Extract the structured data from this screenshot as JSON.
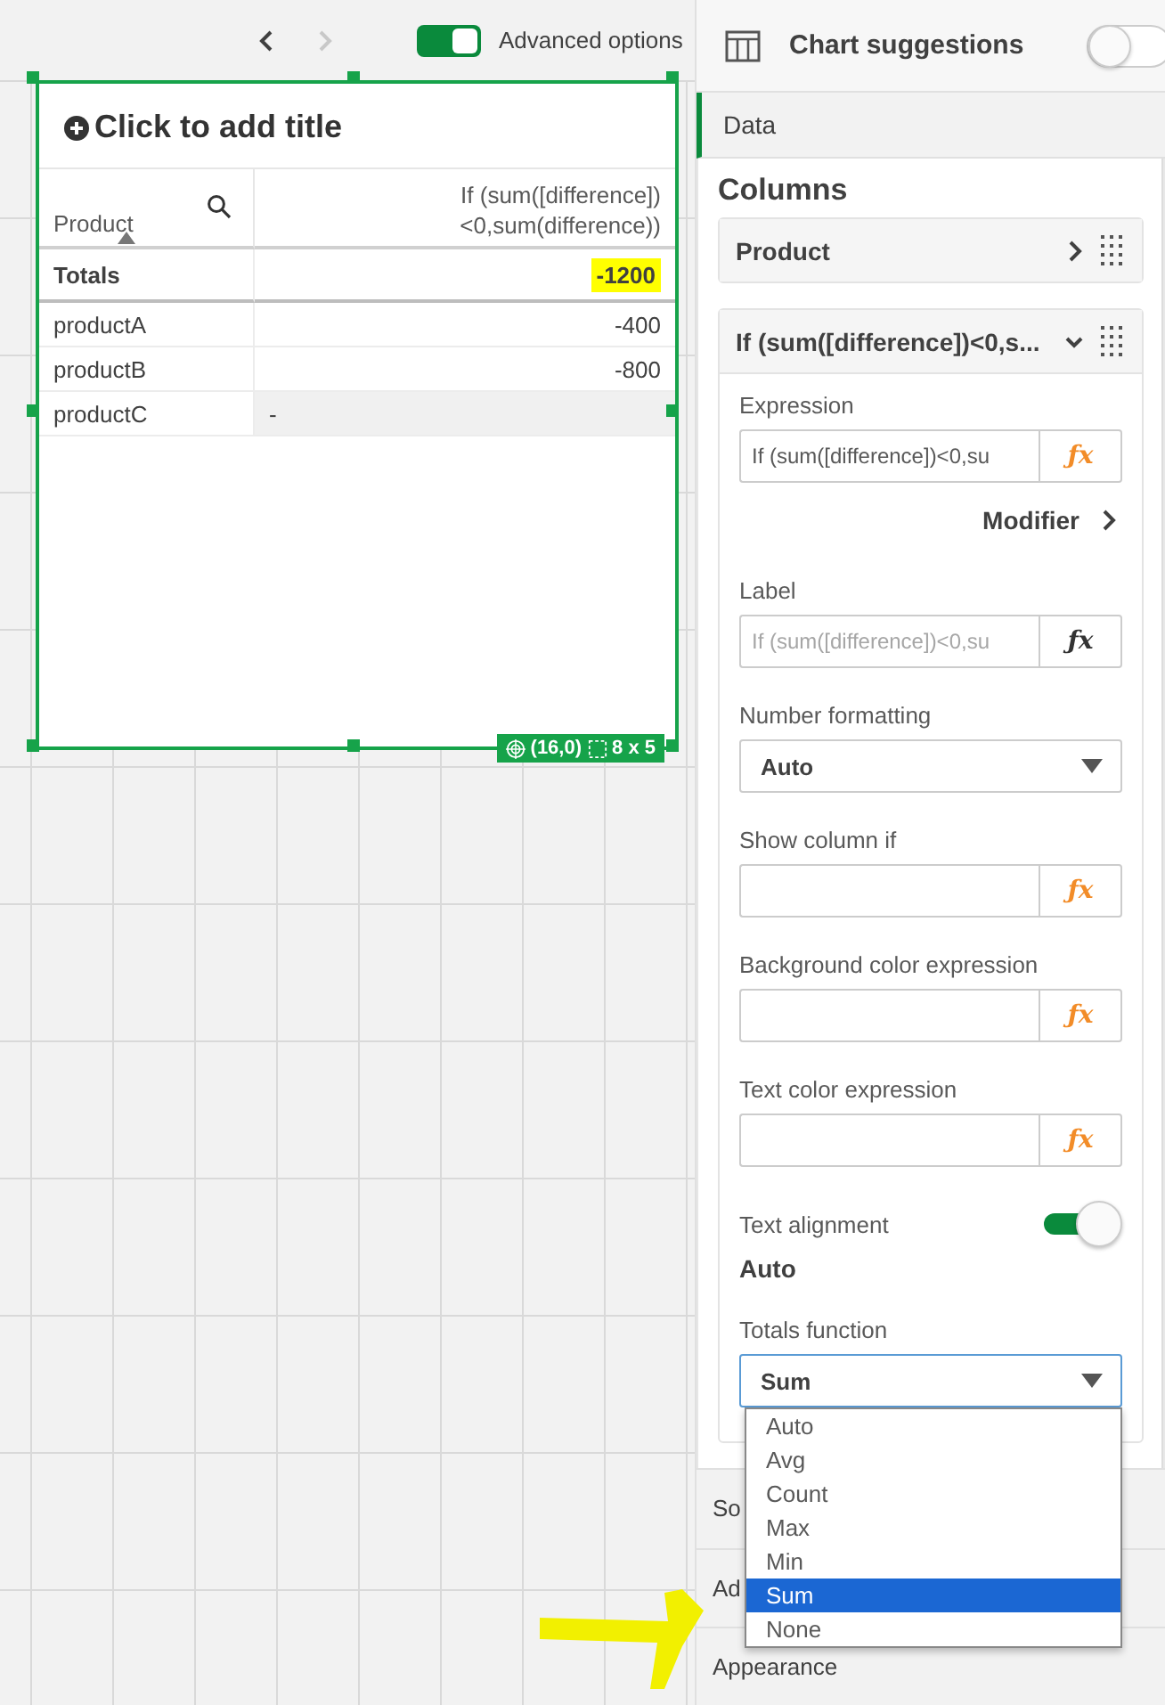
{
  "toolbar": {
    "back_disabled": false,
    "forward_disabled": true,
    "advanced": {
      "label": "Advanced options",
      "on": true
    }
  },
  "card": {
    "title": "Click to add title",
    "columns": [
      {
        "header": "Product"
      },
      {
        "header": "If (sum([difference])\n<0,sum(difference))"
      }
    ],
    "totals": {
      "label": "Totals",
      "value": "-1200",
      "highlighted": true
    },
    "rows": [
      {
        "product": "productA",
        "value": "-400",
        "null": false
      },
      {
        "product": "productB",
        "value": "-800",
        "null": false
      },
      {
        "product": "productC",
        "value": "-",
        "null": true
      }
    ],
    "position": "(16,0)",
    "size": "8 x 5"
  },
  "panel": {
    "header": {
      "title": "Chart suggestions",
      "on": false
    },
    "tabs": [
      {
        "label": "Data",
        "selected": true
      }
    ],
    "columns_title": "Columns",
    "columns": [
      {
        "label": "Product",
        "expanded": false
      },
      {
        "label": "If (sum([difference])<0,s...",
        "expanded": true
      }
    ],
    "properties": [
      {
        "kind": "field",
        "label": "Expression",
        "value": "If (sum([difference])<0,su",
        "fx": "ƒx",
        "fx_highlighted": true
      },
      {
        "kind": "link",
        "label": "Modifier"
      },
      {
        "kind": "field",
        "label": "Label",
        "placeholder": "If (sum([difference])<0,su",
        "fx": "ƒx",
        "fx_highlighted": false
      },
      {
        "kind": "select",
        "label": "Number formatting",
        "value": "Auto",
        "open": false
      },
      {
        "kind": "field",
        "label": "Show column if",
        "fx": "ƒx",
        "fx_highlighted": true
      },
      {
        "kind": "field",
        "label": "Background color expression",
        "fx": "ƒx",
        "fx_highlighted": true
      },
      {
        "kind": "field",
        "label": "Text color expression",
        "fx": "ƒx",
        "fx_highlighted": true
      },
      {
        "kind": "toggle",
        "label": "Text alignment",
        "value": "Auto",
        "on": true
      },
      {
        "kind": "select",
        "label": "Totals function",
        "value": "Sum",
        "open": true,
        "options": [
          {
            "label": "Auto",
            "selected": false
          },
          {
            "label": "Avg",
            "selected": false
          },
          {
            "label": "Count",
            "selected": false
          },
          {
            "label": "Max",
            "selected": false
          },
          {
            "label": "Min",
            "selected": false
          },
          {
            "label": "Sum",
            "selected": true
          },
          {
            "label": "None",
            "selected": false
          }
        ]
      }
    ],
    "sections": [
      {
        "label": "So"
      },
      {
        "label": "Ad"
      },
      {
        "label": "Appearance"
      }
    ]
  }
}
